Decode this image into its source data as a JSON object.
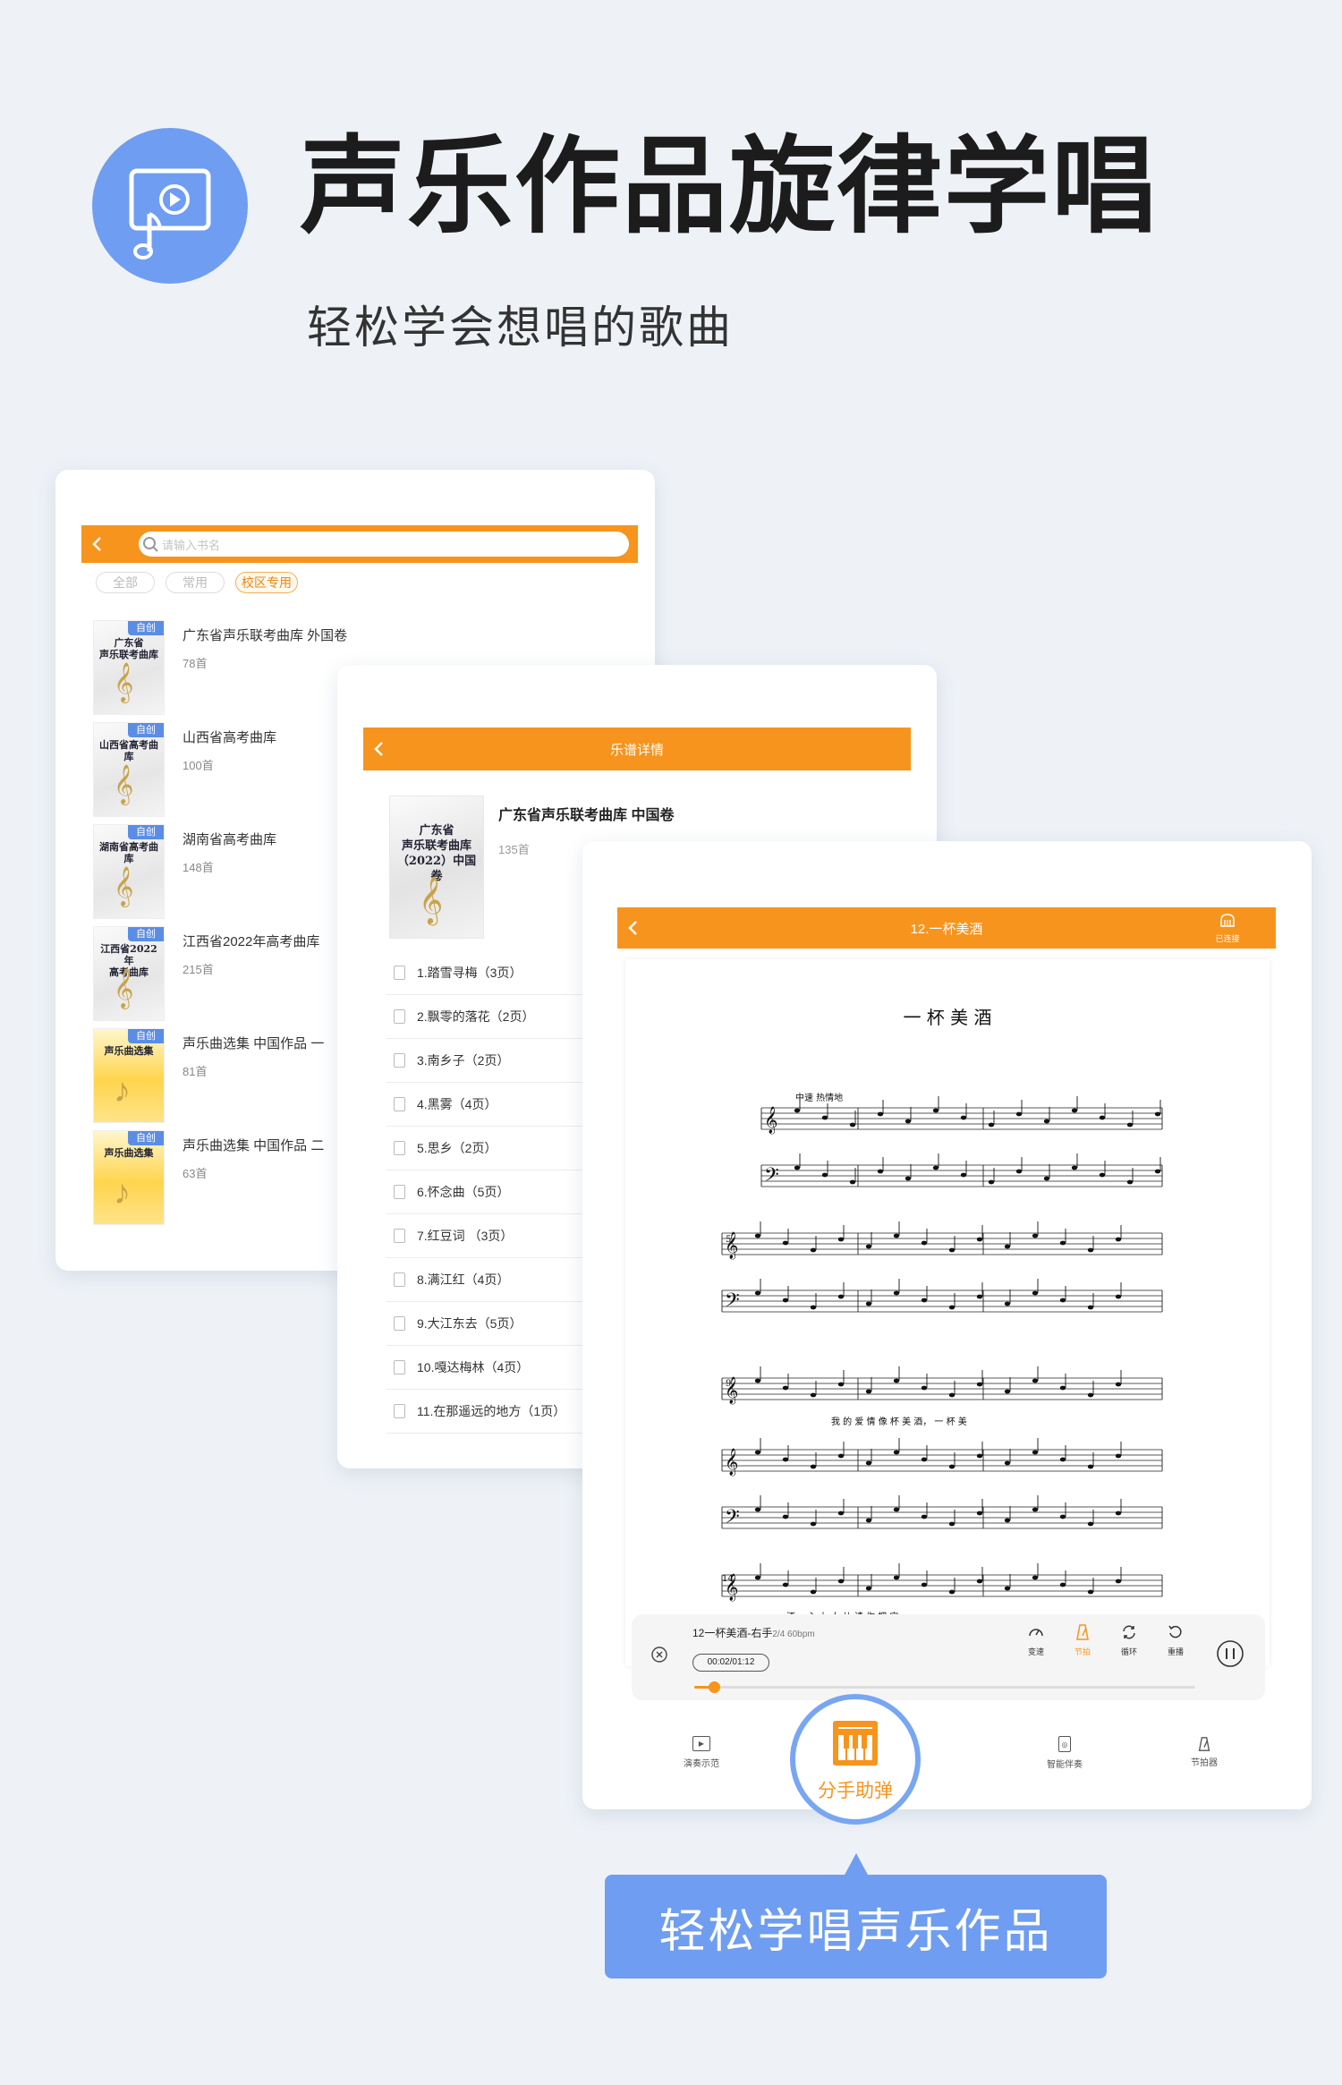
{
  "colors": {
    "accent": "#f7941d",
    "brand_blue": "#6f9df1",
    "background": "#eef2f7"
  },
  "hero": {
    "icon": "video-music-icon",
    "title": "声乐作品旋律学唱",
    "subtitle": "轻松学会想唱的歌曲"
  },
  "library": {
    "search_placeholder": "请输入书名",
    "filters": [
      {
        "label": "全部",
        "active": false
      },
      {
        "label": "常用",
        "active": false
      },
      {
        "label": "校区专用",
        "active": true
      }
    ],
    "tag_label": "自创",
    "books": [
      {
        "name": "广东省声乐联考曲库 外国卷",
        "count": "78首",
        "cover_title": "广东省\n声乐联考曲库",
        "cover_style": "white"
      },
      {
        "name": "山西省高考曲库",
        "count": "100首",
        "cover_title": "山西省高考曲库",
        "cover_style": "white"
      },
      {
        "name": "湖南省高考曲库",
        "count": "148首",
        "cover_title": "湖南省高考曲库",
        "cover_style": "white"
      },
      {
        "name": "江西省2022年高考曲库",
        "count": "215首",
        "cover_title": "江西省2022年\n高考曲库",
        "cover_style": "white"
      },
      {
        "name": "声乐曲选集 中国作品 一",
        "count": "81首",
        "cover_title": "声乐曲选集",
        "cover_style": "yellow"
      },
      {
        "name": "声乐曲选集 中国作品 二",
        "count": "63首",
        "cover_title": "声乐曲选集",
        "cover_style": "yellow"
      }
    ]
  },
  "detail": {
    "title": "乐谱详情",
    "book_name": "广东省声乐联考曲库 中国卷",
    "count": "135首",
    "cover_title": "广东省\n声乐联考曲库\n（2022）中国卷",
    "songs": [
      "1.踏雪寻梅（3页）",
      "2.飘零的落花（2页）",
      "3.南乡子（2页）",
      "4.黑雾（4页）",
      "5.思乡（2页）",
      "6.怀念曲（5页）",
      "7.红豆词 （3页）",
      "8.满江红（4页）",
      "9.大江东去（5页）",
      "10.嘎达梅林（4页）",
      "11.在那遥远的地方（1页）"
    ]
  },
  "score_view": {
    "title": "12.一杯美酒",
    "connected_label": "已连接",
    "score_title": "一 杯 美 酒",
    "tempo_mark": "中速 热情地",
    "measure_numbers": [
      "5",
      "9",
      "14"
    ],
    "lyrics_line1": "我 的 爱 情     像 杯 美 酒，     一 杯 美",
    "lyrics_line2": "酒。                    心 上 人  儿      请 你 把 它",
    "player": {
      "track": "12一杯美酒-右手",
      "meta": "2/4 60bpm",
      "time": "00:02/01:12",
      "progress": 0.04,
      "controls": [
        {
          "label": "变速",
          "icon": "speedometer-icon",
          "active": false
        },
        {
          "label": "节拍",
          "icon": "metronome-icon",
          "active": true
        },
        {
          "label": "循环",
          "icon": "loop-icon",
          "active": false
        },
        {
          "label": "重播",
          "icon": "replay-icon",
          "active": false
        }
      ]
    },
    "nav": [
      {
        "label": "演奏示范",
        "icon": "play-demo-icon"
      },
      {
        "label": "智能伴奏",
        "icon": "speaker-icon"
      },
      {
        "label": "节拍器",
        "icon": "metronome-icon"
      }
    ],
    "fab_label": "分手助弹"
  },
  "callout": "轻松学唱声乐作品"
}
